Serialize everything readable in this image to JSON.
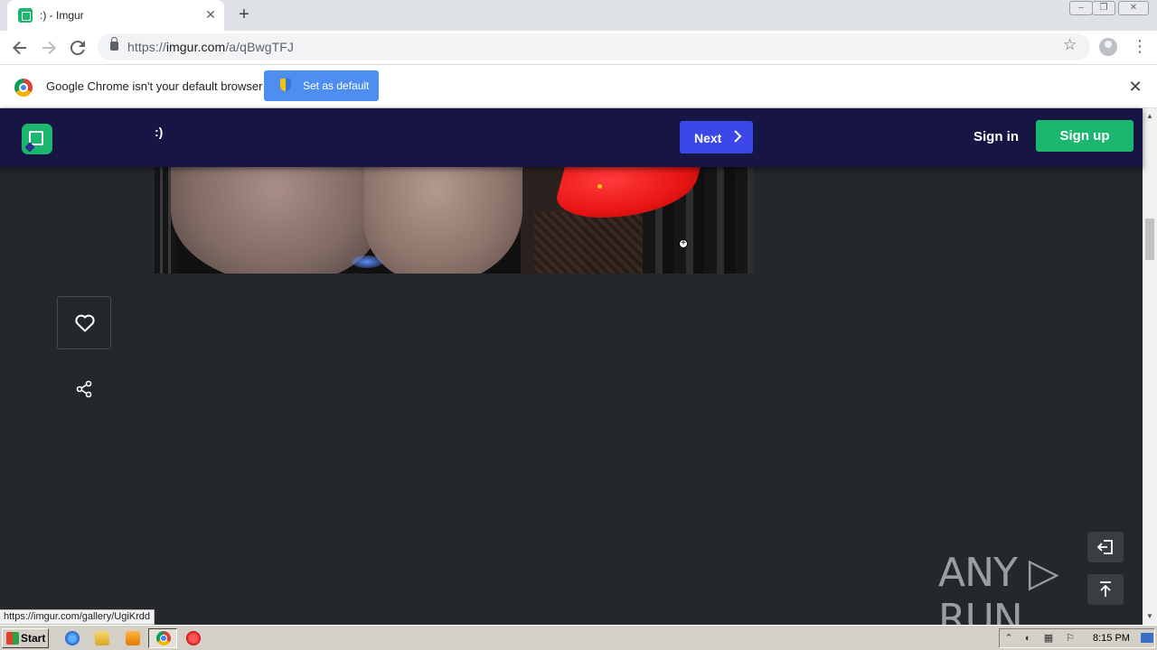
{
  "browser": {
    "tab_title": ":) - Imgur",
    "tab_close": "✕",
    "new_tab": "+",
    "url_scheme": "https://",
    "url_host": "imgur.com",
    "url_path": "/a/qBwgTFJ"
  },
  "infobar": {
    "message": "Google Chrome isn't your default browser",
    "set_default_label": "Set as default",
    "close": "✕"
  },
  "imgur": {
    "post_title": ":)",
    "next_label": "Next",
    "sign_in": "Sign in",
    "sign_up": "Sign up"
  },
  "watermark": "ANY ▷ RUN",
  "status_bar_url": "https://imgur.com/gallery/UgiKrdd",
  "taskbar": {
    "start_label": "Start",
    "clock": "8:15 PM"
  },
  "icons": [
    "back-icon",
    "forward-icon",
    "reload-icon",
    "lock-icon",
    "star-icon",
    "profile-icon",
    "menu-icon",
    "chrome-icon",
    "shield-icon",
    "imgur-logo-icon",
    "chevron-right-icon",
    "heart-icon",
    "share-icon",
    "exit-icon",
    "scroll-top-icon"
  ],
  "colors": {
    "imgur_header": "#171544",
    "next_button": "#3b47e8",
    "sign_up_button": "#1bb76e",
    "page_background": "#24272b",
    "set_default_button": "#4d8ef0"
  }
}
